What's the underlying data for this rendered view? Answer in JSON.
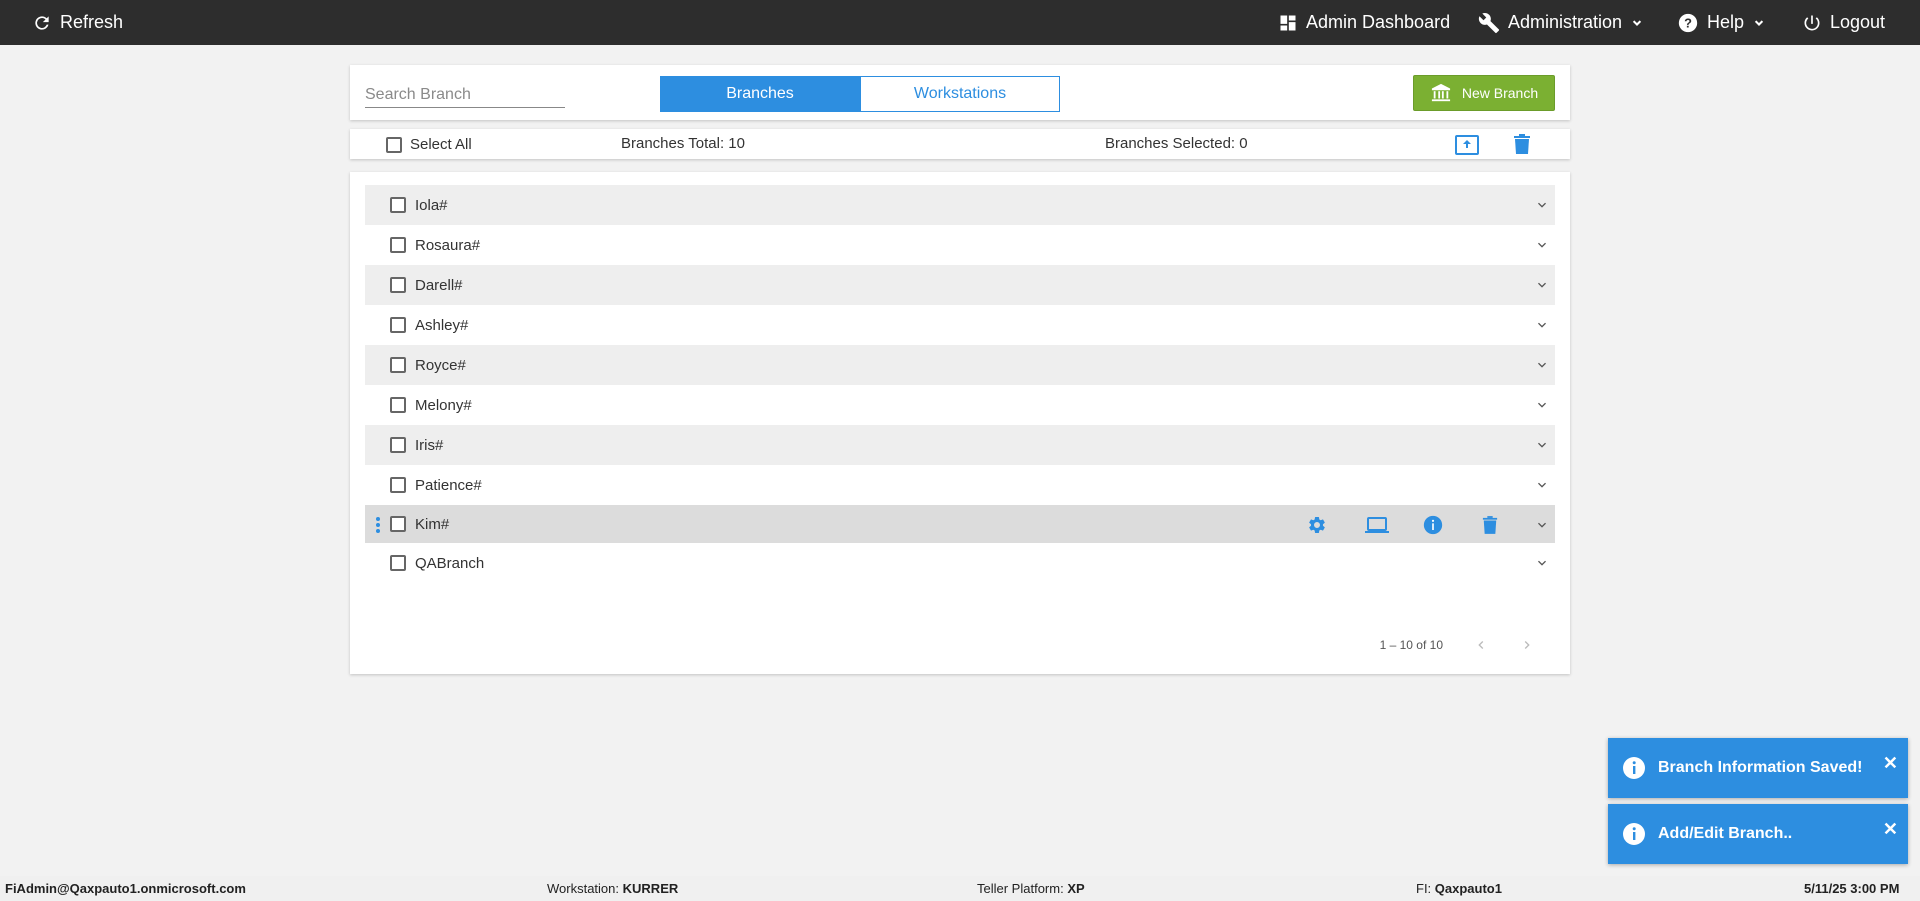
{
  "topbar": {
    "refresh": "Refresh",
    "admin_dashboard": "Admin Dashboard",
    "administration": "Administration",
    "help": "Help",
    "logout": "Logout"
  },
  "header": {
    "search_placeholder": "Search Branch",
    "tabs": [
      {
        "label": "Branches",
        "active": true
      },
      {
        "label": "Workstations",
        "active": false
      }
    ],
    "new_branch": "New Branch"
  },
  "select_bar": {
    "select_all": "Select All",
    "total": "Branches Total: 10",
    "selected": "Branches Selected: 0"
  },
  "branches": [
    {
      "name": "Iola#"
    },
    {
      "name": "Rosaura#"
    },
    {
      "name": "Darell#"
    },
    {
      "name": "Ashley#"
    },
    {
      "name": "Royce#"
    },
    {
      "name": "Melony#"
    },
    {
      "name": "Iris#"
    },
    {
      "name": "Patience#"
    },
    {
      "name": "Kim#"
    },
    {
      "name": "QABranch"
    }
  ],
  "pager": {
    "range": "1 – 10 of 10"
  },
  "toasts": [
    {
      "text": "Branch Information Saved!"
    },
    {
      "text": "Add/Edit Branch.."
    }
  ],
  "footer": {
    "user": "FiAdmin@Qaxpauto1.onmicrosoft.com",
    "workstation_label": "Workstation:",
    "workstation": "KURRER",
    "platform_label": "Teller Platform:",
    "platform": "XP",
    "fi_label": "FI:",
    "fi": "Qaxpauto1",
    "datetime": "5/11/25 3:00 PM"
  },
  "colors": {
    "accent": "#2d8ee0",
    "new_branch": "#7bb032",
    "topbar": "#2d2d2d"
  }
}
